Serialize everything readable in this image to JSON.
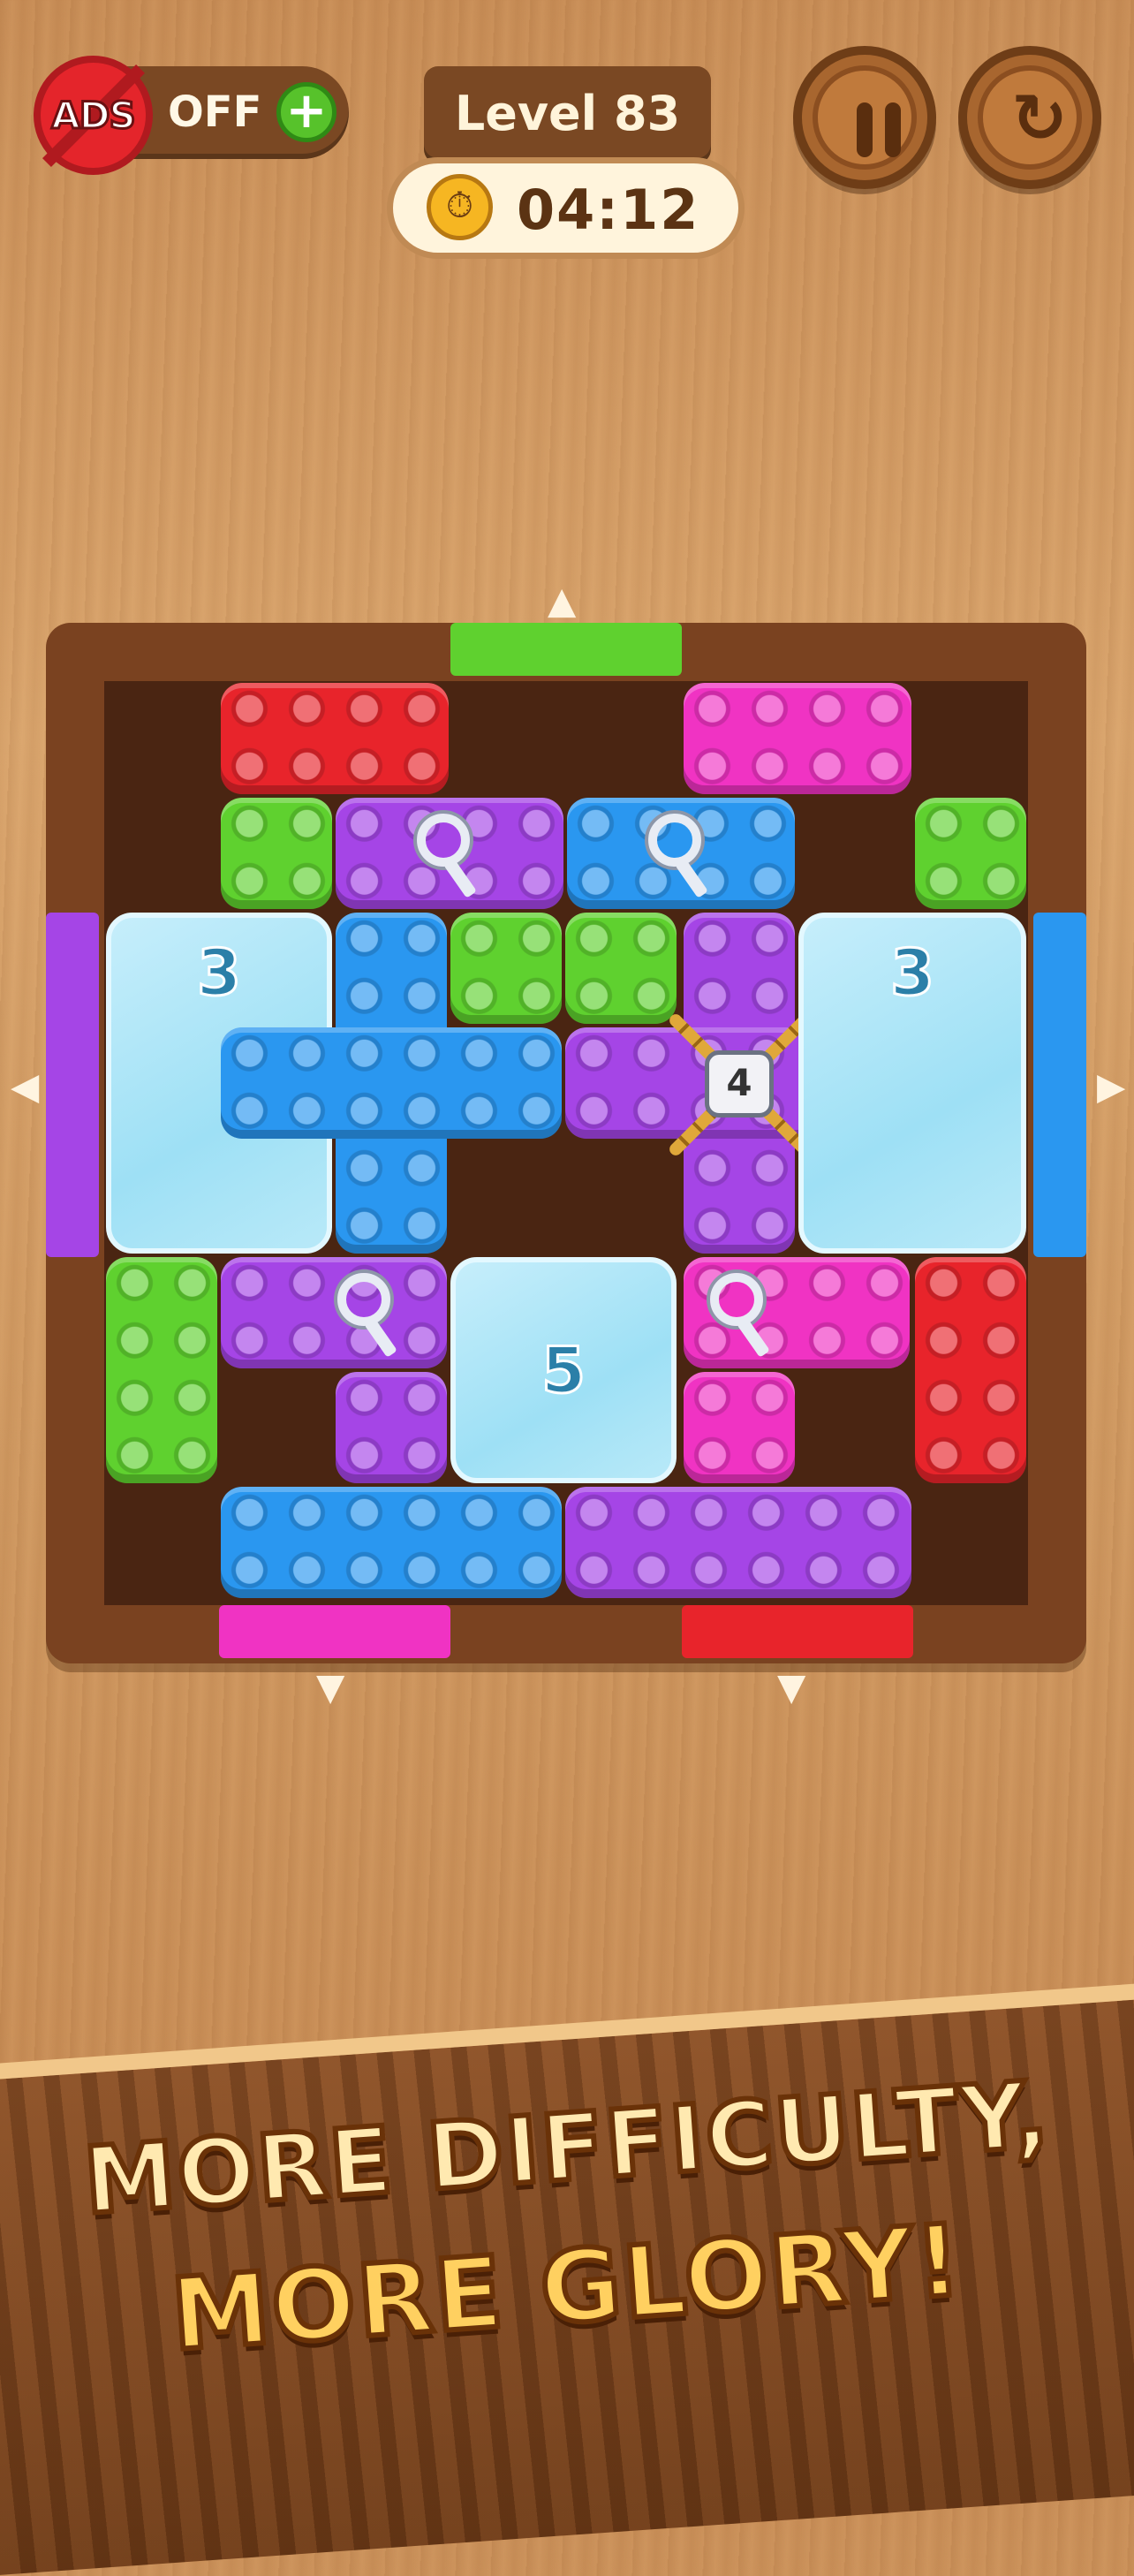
{
  "hud": {
    "ads_badge": "ADS",
    "ads_status": "OFF",
    "ads_add": "+",
    "level": "Level 83",
    "timer": "04:12"
  },
  "board": {
    "ice_blocks": [
      "3",
      "3",
      "5"
    ],
    "lock_count": "4"
  },
  "banner": {
    "line1": "MORE DIFFICULTY,",
    "line2": "MORE GLORY!"
  },
  "colors": {
    "red": "#e8242b",
    "pink": "#f033c3",
    "green": "#5fd12f",
    "purple": "#a545e6",
    "blue": "#2a97f0",
    "wood": "#7a4220"
  },
  "icons": {
    "pause": "pause-icon",
    "restart": "restart-icon",
    "stopwatch": "stopwatch-icon",
    "key": "key-icon",
    "lock": "lock-icon"
  }
}
